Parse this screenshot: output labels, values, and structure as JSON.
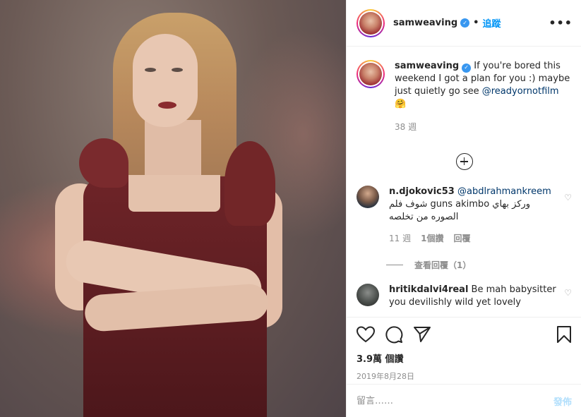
{
  "post": {
    "author": "samweaving",
    "follow_label": "追蹤",
    "dot": "•",
    "more_label": "•••",
    "caption": "If you're bored this weekend I got a plan for you :) maybe just quietly go see ",
    "caption_mention": "@readyornotfilm",
    "caption_emoji": "🤗",
    "caption_age": "38 週"
  },
  "comments": [
    {
      "username": "n.djokovic53",
      "mention": "@abdlrahmankreem",
      "text": "وركز بهاي guns akimbo شوف فلم الصوره من تخلصه",
      "age": "11 週",
      "likes": "1個讚",
      "reply_label": "回覆",
      "view_replies": "查看回覆（1）"
    },
    {
      "username": "hritikdalvi4real",
      "text": "Be mah babysitter you devilishly wild yet lovely"
    }
  ],
  "stats": {
    "views": "3.9萬 個讚",
    "date": "2019年8月28日"
  },
  "composer": {
    "placeholder": "留言……",
    "post_label": "發佈"
  },
  "icons": {
    "like": "heart-icon",
    "comment": "comment-icon",
    "share": "paper-plane-icon",
    "save": "bookmark-icon",
    "expand": "plus-circle-icon",
    "verified": "verified-badge-icon"
  },
  "colors": {
    "link": "#0095f6",
    "mention": "#00376b",
    "muted": "#8e8e8e",
    "verified": "#3897f0"
  }
}
